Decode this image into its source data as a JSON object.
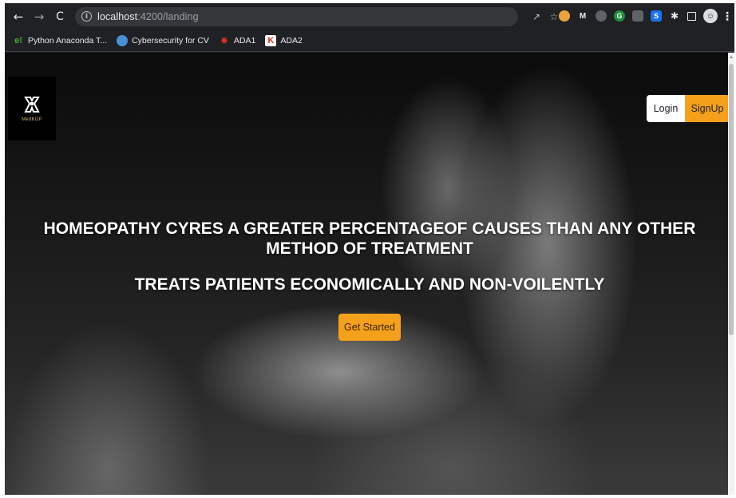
{
  "browser": {
    "url_host": "localhost",
    "url_path": ":4200/landing",
    "bookmarks": [
      {
        "label": "Python Anaconda T...",
        "icon": "e!",
        "color": "#43b02a"
      },
      {
        "label": "Cybersecurity for CV",
        "icon": "globe",
        "color": "#4a90d9"
      },
      {
        "label": "ADA1",
        "icon": "gear",
        "color": "#d93025"
      },
      {
        "label": "ADA2",
        "icon": "K",
        "color": "#d93025"
      }
    ]
  },
  "page": {
    "logo_text": "MedKGP",
    "login_label": "Login",
    "signup_label": "SignUp",
    "hero_line1": "HOMEOPATHY CYRES A GREATER PERCENTAGEOF CAUSES THAN ANY OTHER METHOD OF TREATMENT",
    "hero_line2": "TREATS PATIENTS ECONOMICALLY AND NON-VOILENTLY",
    "cta_label": "Get Started"
  },
  "colors": {
    "accent": "#f5a01a",
    "toolbar": "#202124"
  }
}
